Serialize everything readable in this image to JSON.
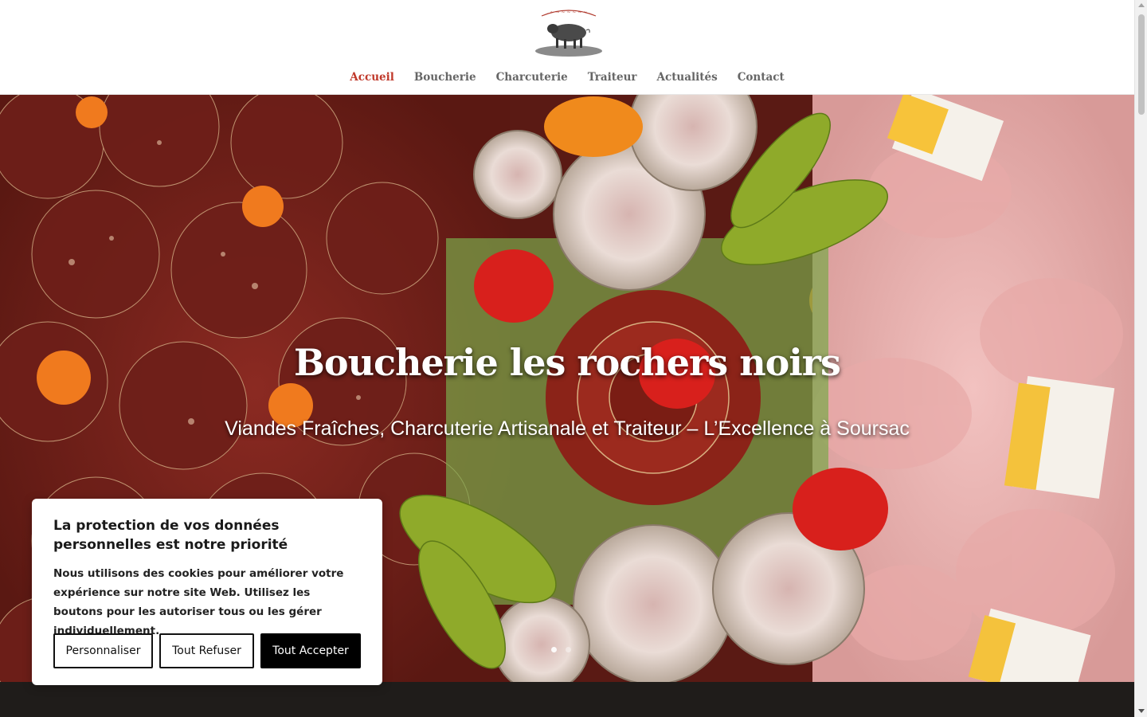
{
  "header": {
    "logo_alt": "Boucherie Les Rochers Noirs",
    "nav": [
      {
        "label": "Accueil",
        "active": true
      },
      {
        "label": "Boucherie",
        "active": false
      },
      {
        "label": "Charcuterie",
        "active": false
      },
      {
        "label": "Traiteur",
        "active": false
      },
      {
        "label": "Actualités",
        "active": false
      },
      {
        "label": "Contact",
        "active": false
      }
    ],
    "accent_color": "#c0392b"
  },
  "hero": {
    "title": "Boucherie les rochers noirs",
    "subtitle": "Viandes Fraîches, Charcuterie Artisanale et Traiteur – L’Excellence à Soursac"
  },
  "cookie": {
    "title": "La protection de vos données personnelles est notre priorité",
    "text": "Nous utilisons des cookies pour améliorer votre expérience sur notre site Web. Utilisez les boutons pour les autoriser tous ou les gérer individuellement.",
    "btn_customize": "Personnaliser",
    "btn_refuse": "Tout Refuser",
    "btn_accept": "Tout Accepter"
  }
}
